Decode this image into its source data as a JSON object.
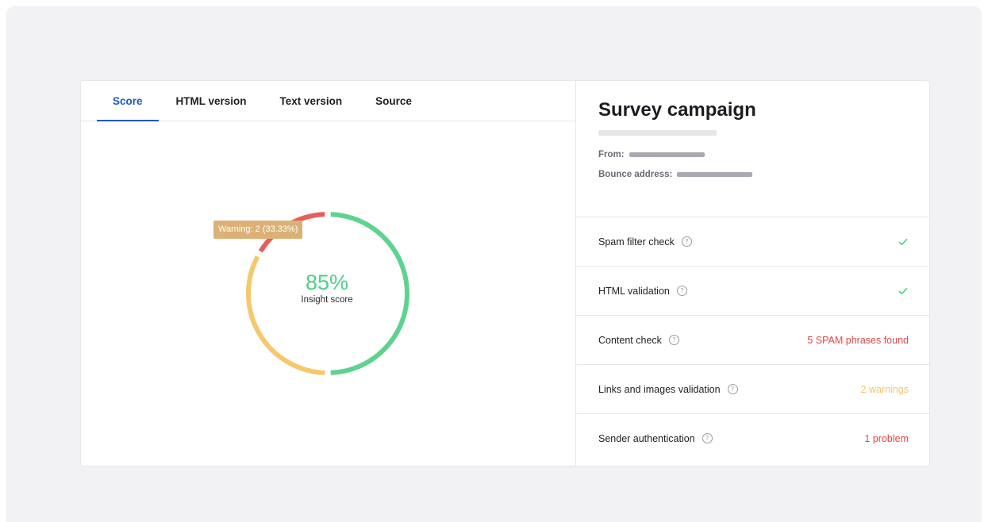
{
  "tabs": [
    {
      "label": "Score",
      "active": true
    },
    {
      "label": "HTML version",
      "active": false
    },
    {
      "label": "Text version",
      "active": false
    },
    {
      "label": "Source",
      "active": false
    }
  ],
  "score": {
    "value": "85%",
    "label": "Insight score",
    "tooltip": "Warning: 2 (33.33%)",
    "segments": [
      {
        "name": "passed",
        "color": "#5ed38f",
        "fraction": 0.5
      },
      {
        "name": "warning",
        "color": "#f6c86b",
        "fraction": 0.3333
      },
      {
        "name": "error",
        "color": "#e95c5c",
        "fraction": 0.1667
      }
    ]
  },
  "campaign": {
    "title": "Survey campaign",
    "from_label": "From:",
    "bounce_label": "Bounce address:"
  },
  "checks": [
    {
      "label": "Spam filter check",
      "status": "",
      "status_type": "ok"
    },
    {
      "label": "HTML validation",
      "status": "",
      "status_type": "ok"
    },
    {
      "label": "Content check",
      "status": "5 SPAM phrases found",
      "status_type": "error"
    },
    {
      "label": "Links and images validation",
      "status": "2 warnings",
      "status_type": "warning"
    },
    {
      "label": "Sender authentication",
      "status": "1 problem",
      "status_type": "error"
    }
  ],
  "colors": {
    "accent": "#1f57c3",
    "ok": "#4fcf86",
    "error": "#e04848",
    "warning": "#f2c56a"
  },
  "icons": {
    "help": "question-circle-icon",
    "ok": "checkmark-icon"
  }
}
